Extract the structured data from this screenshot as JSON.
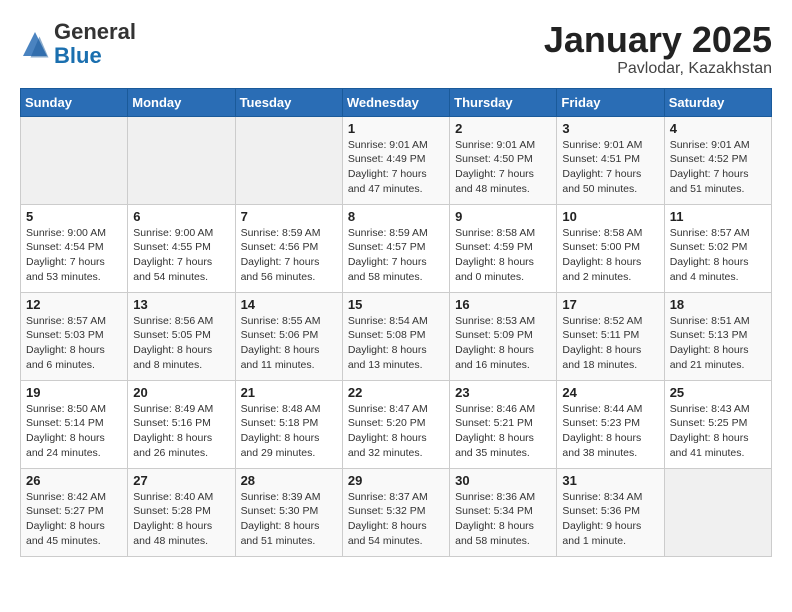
{
  "header": {
    "logo": {
      "general": "General",
      "blue": "Blue"
    },
    "title": "January 2025",
    "subtitle": "Pavlodar, Kazakhstan"
  },
  "weekdays": [
    "Sunday",
    "Monday",
    "Tuesday",
    "Wednesday",
    "Thursday",
    "Friday",
    "Saturday"
  ],
  "weeks": [
    [
      {
        "day": "",
        "info": ""
      },
      {
        "day": "",
        "info": ""
      },
      {
        "day": "",
        "info": ""
      },
      {
        "day": "1",
        "info": "Sunrise: 9:01 AM\nSunset: 4:49 PM\nDaylight: 7 hours\nand 47 minutes."
      },
      {
        "day": "2",
        "info": "Sunrise: 9:01 AM\nSunset: 4:50 PM\nDaylight: 7 hours\nand 48 minutes."
      },
      {
        "day": "3",
        "info": "Sunrise: 9:01 AM\nSunset: 4:51 PM\nDaylight: 7 hours\nand 50 minutes."
      },
      {
        "day": "4",
        "info": "Sunrise: 9:01 AM\nSunset: 4:52 PM\nDaylight: 7 hours\nand 51 minutes."
      }
    ],
    [
      {
        "day": "5",
        "info": "Sunrise: 9:00 AM\nSunset: 4:54 PM\nDaylight: 7 hours\nand 53 minutes."
      },
      {
        "day": "6",
        "info": "Sunrise: 9:00 AM\nSunset: 4:55 PM\nDaylight: 7 hours\nand 54 minutes."
      },
      {
        "day": "7",
        "info": "Sunrise: 8:59 AM\nSunset: 4:56 PM\nDaylight: 7 hours\nand 56 minutes."
      },
      {
        "day": "8",
        "info": "Sunrise: 8:59 AM\nSunset: 4:57 PM\nDaylight: 7 hours\nand 58 minutes."
      },
      {
        "day": "9",
        "info": "Sunrise: 8:58 AM\nSunset: 4:59 PM\nDaylight: 8 hours\nand 0 minutes."
      },
      {
        "day": "10",
        "info": "Sunrise: 8:58 AM\nSunset: 5:00 PM\nDaylight: 8 hours\nand 2 minutes."
      },
      {
        "day": "11",
        "info": "Sunrise: 8:57 AM\nSunset: 5:02 PM\nDaylight: 8 hours\nand 4 minutes."
      }
    ],
    [
      {
        "day": "12",
        "info": "Sunrise: 8:57 AM\nSunset: 5:03 PM\nDaylight: 8 hours\nand 6 minutes."
      },
      {
        "day": "13",
        "info": "Sunrise: 8:56 AM\nSunset: 5:05 PM\nDaylight: 8 hours\nand 8 minutes."
      },
      {
        "day": "14",
        "info": "Sunrise: 8:55 AM\nSunset: 5:06 PM\nDaylight: 8 hours\nand 11 minutes."
      },
      {
        "day": "15",
        "info": "Sunrise: 8:54 AM\nSunset: 5:08 PM\nDaylight: 8 hours\nand 13 minutes."
      },
      {
        "day": "16",
        "info": "Sunrise: 8:53 AM\nSunset: 5:09 PM\nDaylight: 8 hours\nand 16 minutes."
      },
      {
        "day": "17",
        "info": "Sunrise: 8:52 AM\nSunset: 5:11 PM\nDaylight: 8 hours\nand 18 minutes."
      },
      {
        "day": "18",
        "info": "Sunrise: 8:51 AM\nSunset: 5:13 PM\nDaylight: 8 hours\nand 21 minutes."
      }
    ],
    [
      {
        "day": "19",
        "info": "Sunrise: 8:50 AM\nSunset: 5:14 PM\nDaylight: 8 hours\nand 24 minutes."
      },
      {
        "day": "20",
        "info": "Sunrise: 8:49 AM\nSunset: 5:16 PM\nDaylight: 8 hours\nand 26 minutes."
      },
      {
        "day": "21",
        "info": "Sunrise: 8:48 AM\nSunset: 5:18 PM\nDaylight: 8 hours\nand 29 minutes."
      },
      {
        "day": "22",
        "info": "Sunrise: 8:47 AM\nSunset: 5:20 PM\nDaylight: 8 hours\nand 32 minutes."
      },
      {
        "day": "23",
        "info": "Sunrise: 8:46 AM\nSunset: 5:21 PM\nDaylight: 8 hours\nand 35 minutes."
      },
      {
        "day": "24",
        "info": "Sunrise: 8:44 AM\nSunset: 5:23 PM\nDaylight: 8 hours\nand 38 minutes."
      },
      {
        "day": "25",
        "info": "Sunrise: 8:43 AM\nSunset: 5:25 PM\nDaylight: 8 hours\nand 41 minutes."
      }
    ],
    [
      {
        "day": "26",
        "info": "Sunrise: 8:42 AM\nSunset: 5:27 PM\nDaylight: 8 hours\nand 45 minutes."
      },
      {
        "day": "27",
        "info": "Sunrise: 8:40 AM\nSunset: 5:28 PM\nDaylight: 8 hours\nand 48 minutes."
      },
      {
        "day": "28",
        "info": "Sunrise: 8:39 AM\nSunset: 5:30 PM\nDaylight: 8 hours\nand 51 minutes."
      },
      {
        "day": "29",
        "info": "Sunrise: 8:37 AM\nSunset: 5:32 PM\nDaylight: 8 hours\nand 54 minutes."
      },
      {
        "day": "30",
        "info": "Sunrise: 8:36 AM\nSunset: 5:34 PM\nDaylight: 8 hours\nand 58 minutes."
      },
      {
        "day": "31",
        "info": "Sunrise: 8:34 AM\nSunset: 5:36 PM\nDaylight: 9 hours\nand 1 minute."
      },
      {
        "day": "",
        "info": ""
      }
    ]
  ]
}
